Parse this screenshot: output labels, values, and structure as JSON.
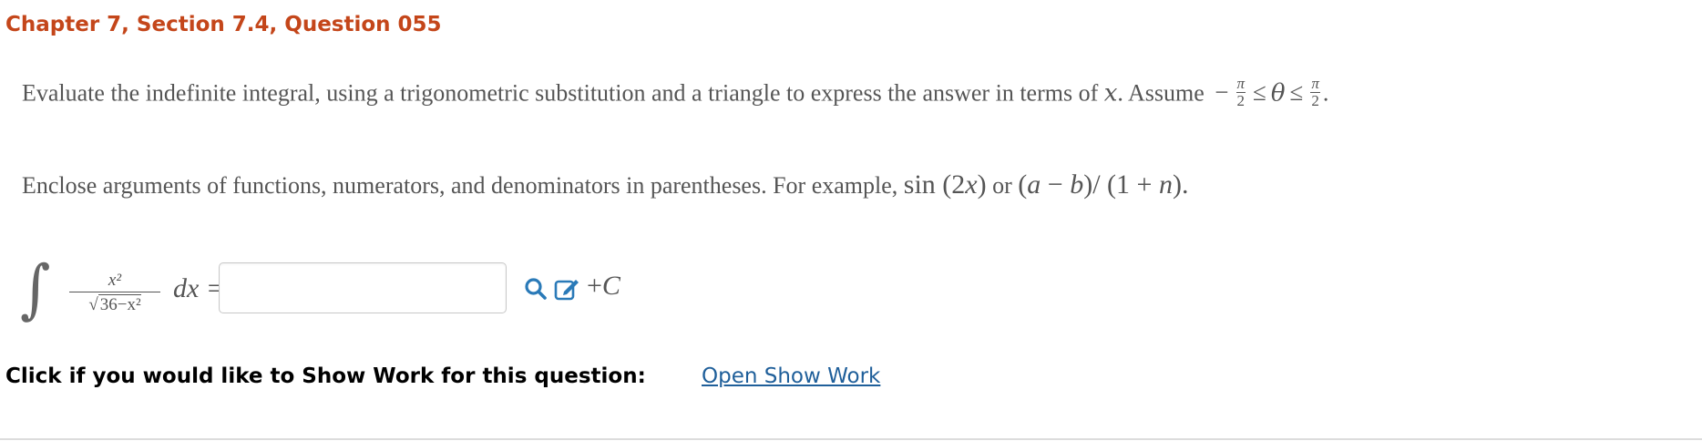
{
  "header": {
    "title": "Chapter 7, Section 7.4, Question 055"
  },
  "instruction": {
    "text": "Evaluate the indefinite integral, using a trigonometric substitution and a triangle to express the answer in terms of",
    "variable": "x",
    "assume_text": ". Assume",
    "minus": "−",
    "pi": "π",
    "two": "2",
    "le": "≤",
    "theta": "θ",
    "period": "."
  },
  "example": {
    "text": "Enclose arguments of functions, numerators, and denominators in parentheses. For example,",
    "sin_expr": "sin (2x)",
    "or": "or",
    "frac_expr": "(a − b)/ (1 + n).",
    "sin_part": "sin",
    "sin_arg_open": "(2",
    "sin_arg_var": "x",
    "sin_arg_close": ")",
    "frac_open": "(",
    "frac_a": "a",
    "frac_minus": " − ",
    "frac_b": "b",
    "frac_mid": ")/ (1 + ",
    "frac_n": "n",
    "frac_close": ")."
  },
  "integral": {
    "sign": "∫",
    "numerator": "x²",
    "radical": "√",
    "denominator": "36−x²",
    "dx": "dx =",
    "plus_c": "+C",
    "plus": "+",
    "c": "C"
  },
  "answer": {
    "value": "",
    "placeholder": ""
  },
  "show_work": {
    "label": "Click if you would like to Show Work for this question:",
    "link": "Open Show Work"
  },
  "colors": {
    "header": "#c4461a",
    "link": "#1f5f9a",
    "icon": "#2a7ab8",
    "text": "#555555"
  }
}
